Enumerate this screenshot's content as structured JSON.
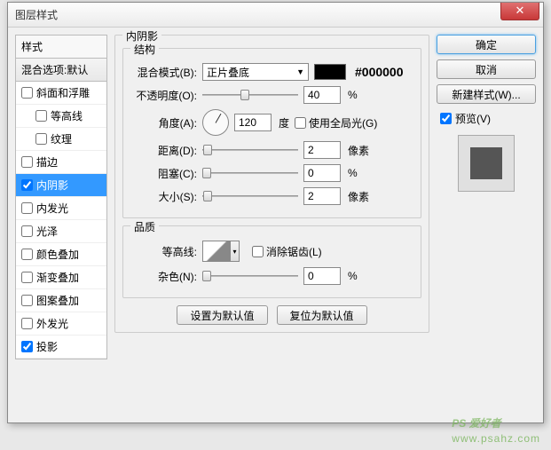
{
  "dialog": {
    "title": "图层样式"
  },
  "left": {
    "header": "样式",
    "subheader": "混合选项:默认",
    "items": [
      {
        "label": "斜面和浮雕",
        "checked": false,
        "indent": false
      },
      {
        "label": "等高线",
        "checked": false,
        "indent": true
      },
      {
        "label": "纹理",
        "checked": false,
        "indent": true
      },
      {
        "label": "描边",
        "checked": false,
        "indent": false
      },
      {
        "label": "内阴影",
        "checked": true,
        "selected": true,
        "indent": false
      },
      {
        "label": "内发光",
        "checked": false,
        "indent": false
      },
      {
        "label": "光泽",
        "checked": false,
        "indent": false
      },
      {
        "label": "颜色叠加",
        "checked": false,
        "indent": false
      },
      {
        "label": "渐变叠加",
        "checked": false,
        "indent": false
      },
      {
        "label": "图案叠加",
        "checked": false,
        "indent": false
      },
      {
        "label": "外发光",
        "checked": false,
        "indent": false
      },
      {
        "label": "投影",
        "checked": true,
        "indent": false
      }
    ]
  },
  "center": {
    "title": "内阴影",
    "structure": {
      "title": "结构",
      "blend_label": "混合模式(B):",
      "blend_value": "正片叠底",
      "hex": "#000000",
      "opacity_label": "不透明度(O):",
      "opacity_value": "40",
      "angle_label": "角度(A):",
      "angle_value": "120",
      "angle_unit": "度",
      "global_label": "使用全局光(G)",
      "distance_label": "距离(D):",
      "distance_value": "2",
      "distance_unit": "像素",
      "choke_label": "阻塞(C):",
      "choke_value": "0",
      "size_label": "大小(S):",
      "size_value": "2",
      "size_unit": "像素",
      "percent": "%"
    },
    "quality": {
      "title": "品质",
      "contour_label": "等高线:",
      "antialias_label": "消除锯齿(L)",
      "noise_label": "杂色(N):",
      "noise_value": "0",
      "percent": "%"
    },
    "buttons": {
      "default": "设置为默认值",
      "reset": "复位为默认值"
    }
  },
  "right": {
    "ok": "确定",
    "cancel": "取消",
    "newstyle": "新建样式(W)...",
    "preview": "预览(V)"
  },
  "watermark": {
    "text": "PS 爱好者",
    "url": "www.psahz.com"
  }
}
